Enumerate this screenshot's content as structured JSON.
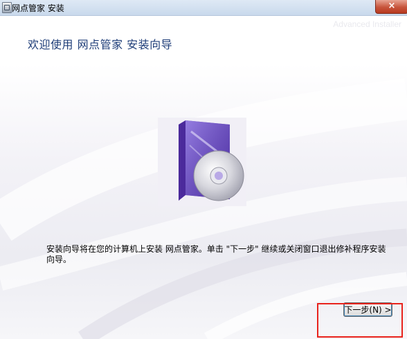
{
  "window": {
    "title": "网点管家 安装",
    "close_symbol": "×",
    "icon": "installer-icon"
  },
  "banner": {
    "watermark": "Advanced Installer",
    "heading": "欢迎使用 网点管家 安装向导"
  },
  "product_image": {
    "icon": "software-box-with-cd"
  },
  "description": "安装向导将在您的计算机上安装 网点管家。单击 \"下一步\" 继续或关闭窗口退出修补程序安装向导。",
  "buttons": {
    "next": "下一步(N) >"
  },
  "colors": {
    "heading": "#1e3d78",
    "highlight": "#e8231c"
  }
}
